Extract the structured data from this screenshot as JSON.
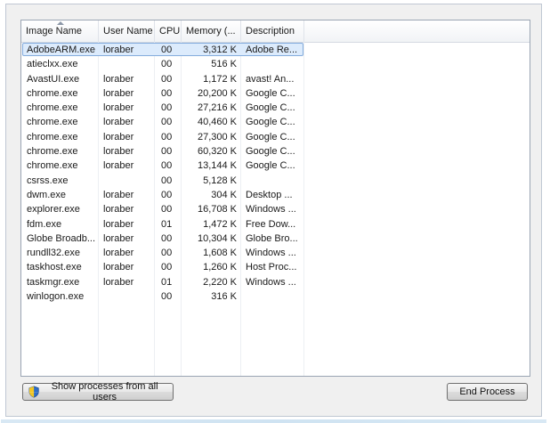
{
  "columns": {
    "name": "Image Name",
    "user": "User Name",
    "cpu": "CPU",
    "memory": "Memory (...",
    "description": "Description"
  },
  "rows": [
    {
      "name": "AdobeARM.exe",
      "user": "loraber",
      "cpu": "00",
      "memory": "3,312 K",
      "description": "Adobe Re...",
      "selected": true
    },
    {
      "name": "atieclxx.exe",
      "user": "",
      "cpu": "00",
      "memory": "516 K",
      "description": ""
    },
    {
      "name": "AvastUI.exe",
      "user": "loraber",
      "cpu": "00",
      "memory": "1,172 K",
      "description": "avast! An..."
    },
    {
      "name": "chrome.exe",
      "user": "loraber",
      "cpu": "00",
      "memory": "20,200 K",
      "description": "Google C..."
    },
    {
      "name": "chrome.exe",
      "user": "loraber",
      "cpu": "00",
      "memory": "27,216 K",
      "description": "Google C..."
    },
    {
      "name": "chrome.exe",
      "user": "loraber",
      "cpu": "00",
      "memory": "40,460 K",
      "description": "Google C..."
    },
    {
      "name": "chrome.exe",
      "user": "loraber",
      "cpu": "00",
      "memory": "27,300 K",
      "description": "Google C..."
    },
    {
      "name": "chrome.exe",
      "user": "loraber",
      "cpu": "00",
      "memory": "60,320 K",
      "description": "Google C..."
    },
    {
      "name": "chrome.exe",
      "user": "loraber",
      "cpu": "00",
      "memory": "13,144 K",
      "description": "Google C..."
    },
    {
      "name": "csrss.exe",
      "user": "",
      "cpu": "00",
      "memory": "5,128 K",
      "description": ""
    },
    {
      "name": "dwm.exe",
      "user": "loraber",
      "cpu": "00",
      "memory": "304 K",
      "description": "Desktop ..."
    },
    {
      "name": "explorer.exe",
      "user": "loraber",
      "cpu": "00",
      "memory": "16,708 K",
      "description": "Windows ..."
    },
    {
      "name": "fdm.exe",
      "user": "loraber",
      "cpu": "01",
      "memory": "1,472 K",
      "description": "Free Dow..."
    },
    {
      "name": "Globe Broadb...",
      "user": "loraber",
      "cpu": "00",
      "memory": "10,304 K",
      "description": "Globe Bro..."
    },
    {
      "name": "rundll32.exe",
      "user": "loraber",
      "cpu": "00",
      "memory": "1,608 K",
      "description": "Windows ..."
    },
    {
      "name": "taskhost.exe",
      "user": "loraber",
      "cpu": "00",
      "memory": "1,260 K",
      "description": "Host Proc..."
    },
    {
      "name": "taskmgr.exe",
      "user": "loraber",
      "cpu": "01",
      "memory": "2,220 K",
      "description": "Windows ..."
    },
    {
      "name": "winlogon.exe",
      "user": "",
      "cpu": "00",
      "memory": "316 K",
      "description": ""
    }
  ],
  "buttons": {
    "show_all": "Show processes from all users",
    "end_process": "End Process"
  },
  "icons": {
    "shield": "uac-shield-icon",
    "sort": "sort-ascending-icon"
  },
  "colors": {
    "selection_bg": "#dcebfc",
    "selection_border": "#84acdd"
  }
}
